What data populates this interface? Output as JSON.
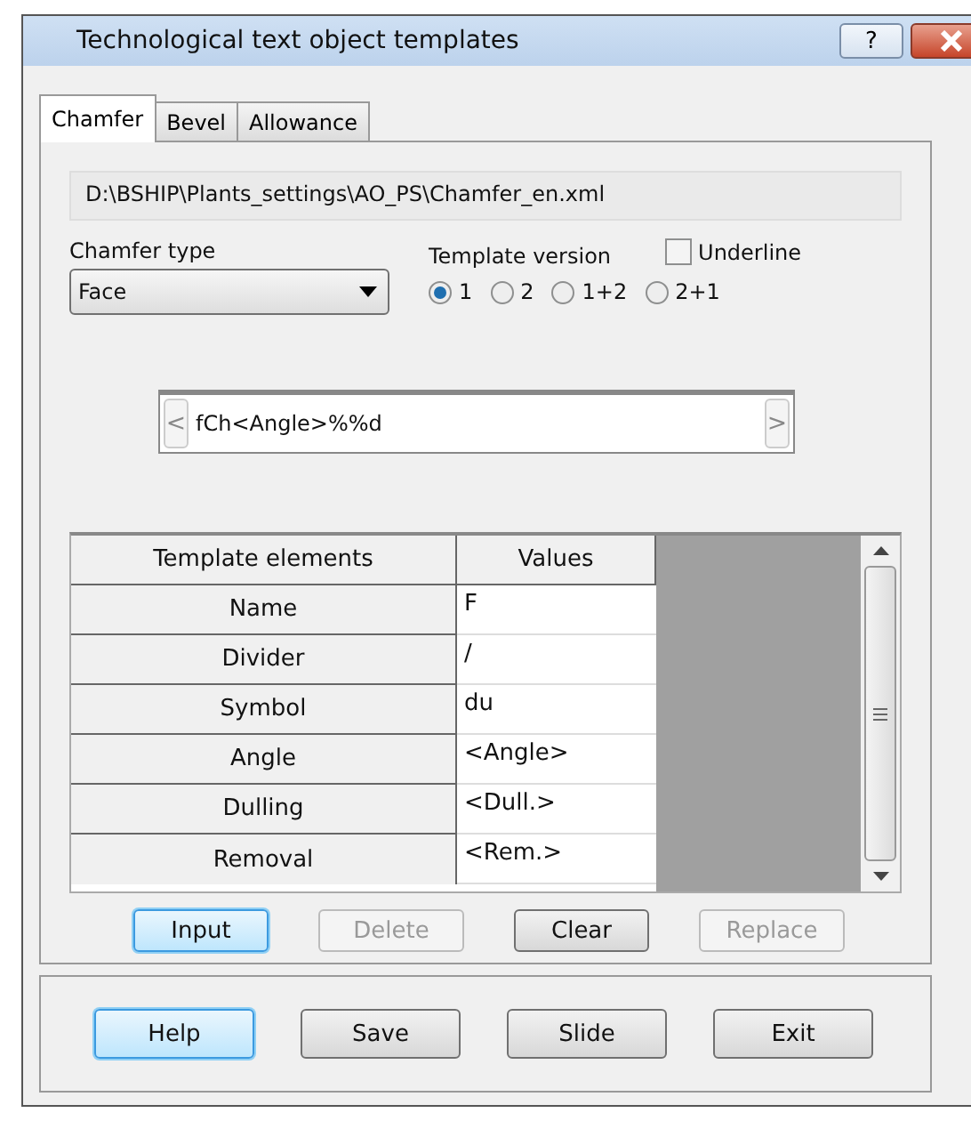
{
  "window": {
    "title": "Technological text object templates",
    "help_button": "?"
  },
  "tabs": [
    {
      "label": "Chamfer",
      "selected": true
    },
    {
      "label": "Bevel",
      "selected": false
    },
    {
      "label": "Allowance",
      "selected": false
    }
  ],
  "file_path": "D:\\BSHIP\\Plants_settings\\AO_PS\\Chamfer_en.xml",
  "chamfer_type": {
    "label": "Chamfer type",
    "value": "Face"
  },
  "template_version": {
    "label": "Template version",
    "options": [
      {
        "label": "1",
        "selected": true
      },
      {
        "label": "2",
        "selected": false
      },
      {
        "label": "1+2",
        "selected": false
      },
      {
        "label": "2+1",
        "selected": false
      }
    ]
  },
  "underline": {
    "label": "Underline",
    "checked": false
  },
  "template": {
    "prev": "<",
    "value": "fCh<Angle>%%d",
    "next": ">"
  },
  "table": {
    "columns": [
      "Template elements",
      "Values"
    ],
    "rows": [
      {
        "element": "Name",
        "value": "F"
      },
      {
        "element": "Divider",
        "value": "/"
      },
      {
        "element": "Symbol",
        "value": "du"
      },
      {
        "element": "Angle",
        "value": "<Angle>"
      },
      {
        "element": "Dulling",
        "value": "<Dull.>"
      },
      {
        "element": "Removal",
        "value": "<Rem.>"
      }
    ]
  },
  "table_buttons": [
    {
      "label": "Input",
      "highlighted": true,
      "disabled": false
    },
    {
      "label": "Delete",
      "highlighted": false,
      "disabled": true
    },
    {
      "label": "Clear",
      "highlighted": false,
      "disabled": false
    },
    {
      "label": "Replace",
      "highlighted": false,
      "disabled": true
    }
  ],
  "buttons": [
    {
      "label": "Help",
      "highlighted": true,
      "disabled": false
    },
    {
      "label": "Save",
      "highlighted": false,
      "disabled": false
    },
    {
      "label": "Slide",
      "highlighted": false,
      "disabled": false
    },
    {
      "label": "Exit",
      "highlighted": false,
      "disabled": false
    }
  ]
}
